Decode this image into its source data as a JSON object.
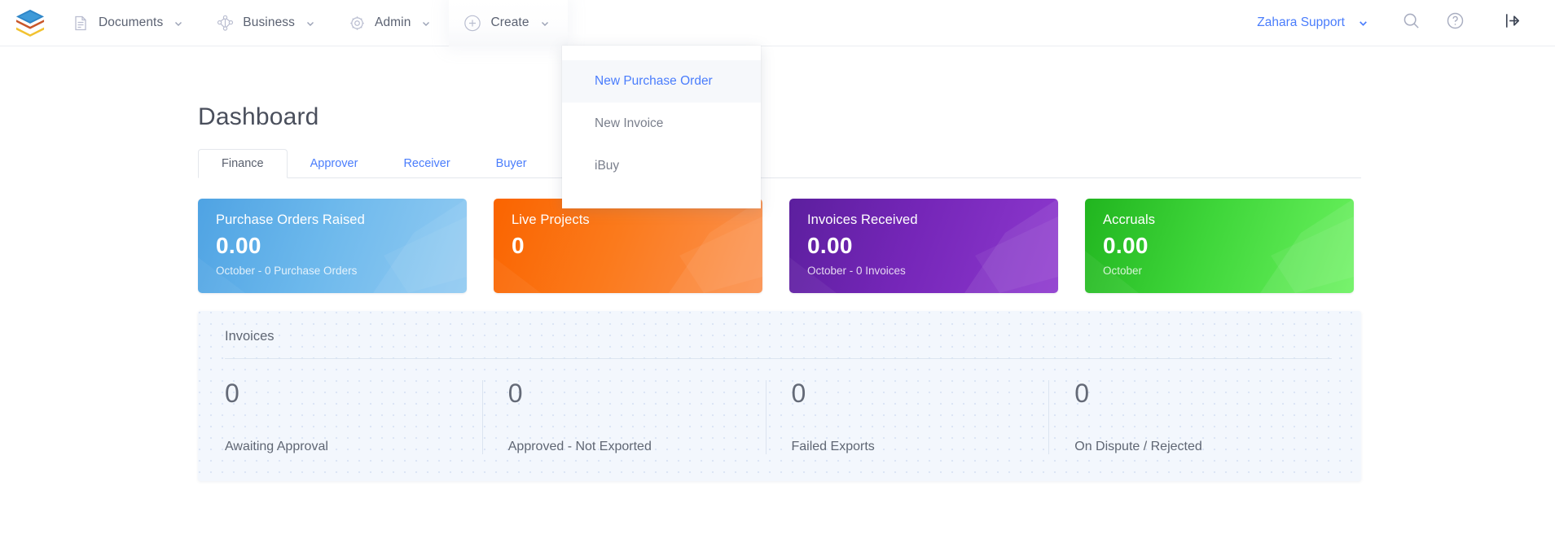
{
  "header": {
    "logo_name": "zahara-layers-logo",
    "nav": [
      {
        "label": "Documents",
        "icon": "document-icon"
      },
      {
        "label": "Business",
        "icon": "business-network-icon"
      },
      {
        "label": "Admin",
        "icon": "gear-icon"
      },
      {
        "label": "Create",
        "icon": "plus-circle-icon"
      }
    ],
    "user": {
      "name": "Zahara Support"
    },
    "actions": [
      {
        "name": "search-icon"
      },
      {
        "name": "help-icon"
      },
      {
        "name": "logout-icon"
      }
    ]
  },
  "create_menu": {
    "items": [
      {
        "label": "New Purchase Order",
        "active": true
      },
      {
        "label": "New Invoice",
        "active": false
      },
      {
        "label": "iBuy",
        "active": false
      }
    ]
  },
  "page": {
    "title": "Dashboard",
    "tabs": [
      {
        "label": "Finance",
        "active": true
      },
      {
        "label": "Approver",
        "active": false
      },
      {
        "label": "Receiver",
        "active": false
      },
      {
        "label": "Buyer",
        "active": false
      }
    ],
    "cards": [
      {
        "title": "Purchase Orders Raised",
        "value": "0.00",
        "sub": "October - 0 Purchase Orders",
        "color": "#6cb8ec",
        "theme": "card-blue"
      },
      {
        "title": "Live Projects",
        "value": "0",
        "sub": "",
        "color": "#fb7a1c",
        "theme": "card-orange"
      },
      {
        "title": "Invoices Received",
        "value": "0.00",
        "sub": "October - 0 Invoices",
        "color": "#7526b8",
        "theme": "card-purple"
      },
      {
        "title": "Accruals",
        "value": "0.00",
        "sub": "October",
        "color": "#3fd63a",
        "theme": "card-green"
      }
    ],
    "invoices_panel": {
      "title": "Invoices",
      "stats": [
        {
          "value": "0",
          "label": "Awaiting Approval"
        },
        {
          "value": "0",
          "label": "Approved - Not Exported"
        },
        {
          "value": "0",
          "label": "Failed Exports"
        },
        {
          "value": "0",
          "label": "On Dispute / Rejected"
        }
      ]
    }
  }
}
